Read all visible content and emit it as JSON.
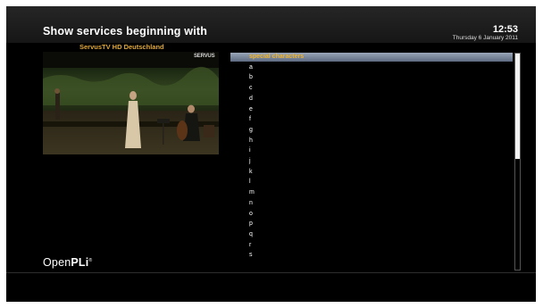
{
  "header": {
    "title": "Show services beginning with",
    "time": "12:53",
    "date": "Thursday 6 January 2011"
  },
  "preview": {
    "channel_name": "ServusTV HD Deutschland",
    "channel_logo_text": "SERVUS"
  },
  "list": {
    "selected_index": 0,
    "items": [
      "special characters",
      "a",
      "b",
      "c",
      "d",
      "e",
      "f",
      "g",
      "h",
      "i",
      "j",
      "k",
      "l",
      "m",
      "n",
      "o",
      "p",
      "q",
      "r",
      "s"
    ]
  },
  "footer": {
    "logo_prefix": "Open",
    "logo_bold": "PLi",
    "logo_mark": "®"
  },
  "colors": {
    "selected_text": "#f0b42a",
    "channel_name": "#e0a838"
  },
  "icons": {
    "scrollbar": "scrollbar-thumb"
  }
}
